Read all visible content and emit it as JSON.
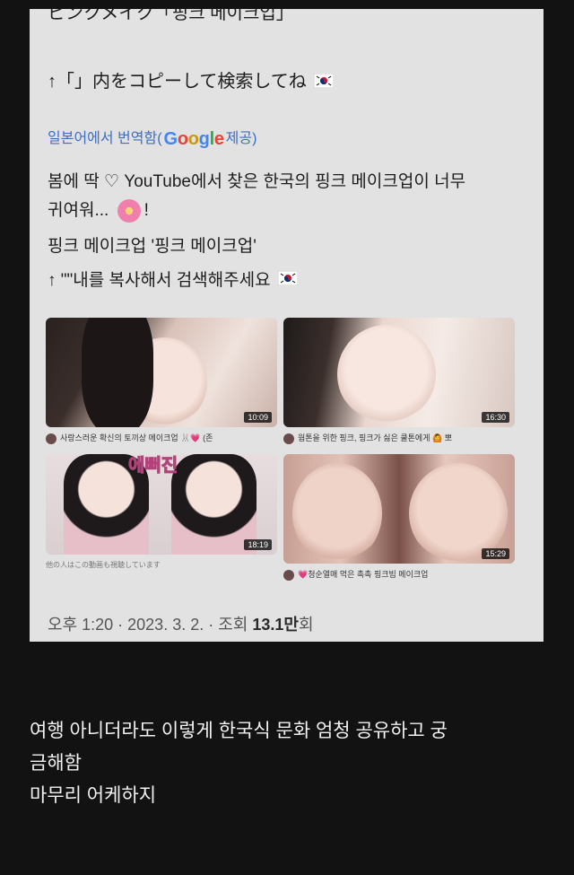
{
  "card": {
    "cut_top_line": "ピンクメイク「핑크 메이크업」",
    "jp_instruction": "↑「」内をコピーして検索してね",
    "translate": {
      "prefix": "일본어에서 번역함(",
      "google": "Google",
      "suffix": " 제공)"
    },
    "kr_line1": "봄에 딱 ♡ YouTube에서 찾은 한국의 핑크 메이크업이 너무",
    "kr_line2a": "귀여워...",
    "kr_line2b": "!",
    "kr_line3": "핑크 메이크업 '핑크 메이크업'",
    "kr_line4": "↑ \"\"내를 복사해서 검색해주세요",
    "videos": [
      {
        "duration": "10:09",
        "title": "사랑스러운 확신의 토끼상 메이크업 🐰💗 (존"
      },
      {
        "duration": "16:30",
        "title": "웜톤을 위한 핑크, 핑크가 싫은 쿨톤에게 🙆 뽀"
      },
      {
        "duration": "18:19",
        "title": "他の人はこの動画も視聴しています",
        "overlay": "에뻐진"
      },
      {
        "duration": "15:29",
        "title": "💗청순열매 먹은 촉촉 핑크빔 메이크업"
      }
    ],
    "meta_prefix": "오후 1:20 · 2023. 3. 2. · 조회 ",
    "meta_views": "13.1만",
    "meta_suffix": "회"
  },
  "post": {
    "line1": "여행 아니더라도 이렇게 한국식 문화 엄청 공유하고 궁",
    "line2": "금해함",
    "line3": "마무리 어케하지"
  },
  "colors": {
    "background": "#121212",
    "card": "#e2e2e2",
    "link": "#3d6ec2",
    "post_text": "#f2f2f2"
  },
  "icons": [
    "korea-flag-icon",
    "flower-emoji-icon",
    "channel-avatar-icon"
  ]
}
